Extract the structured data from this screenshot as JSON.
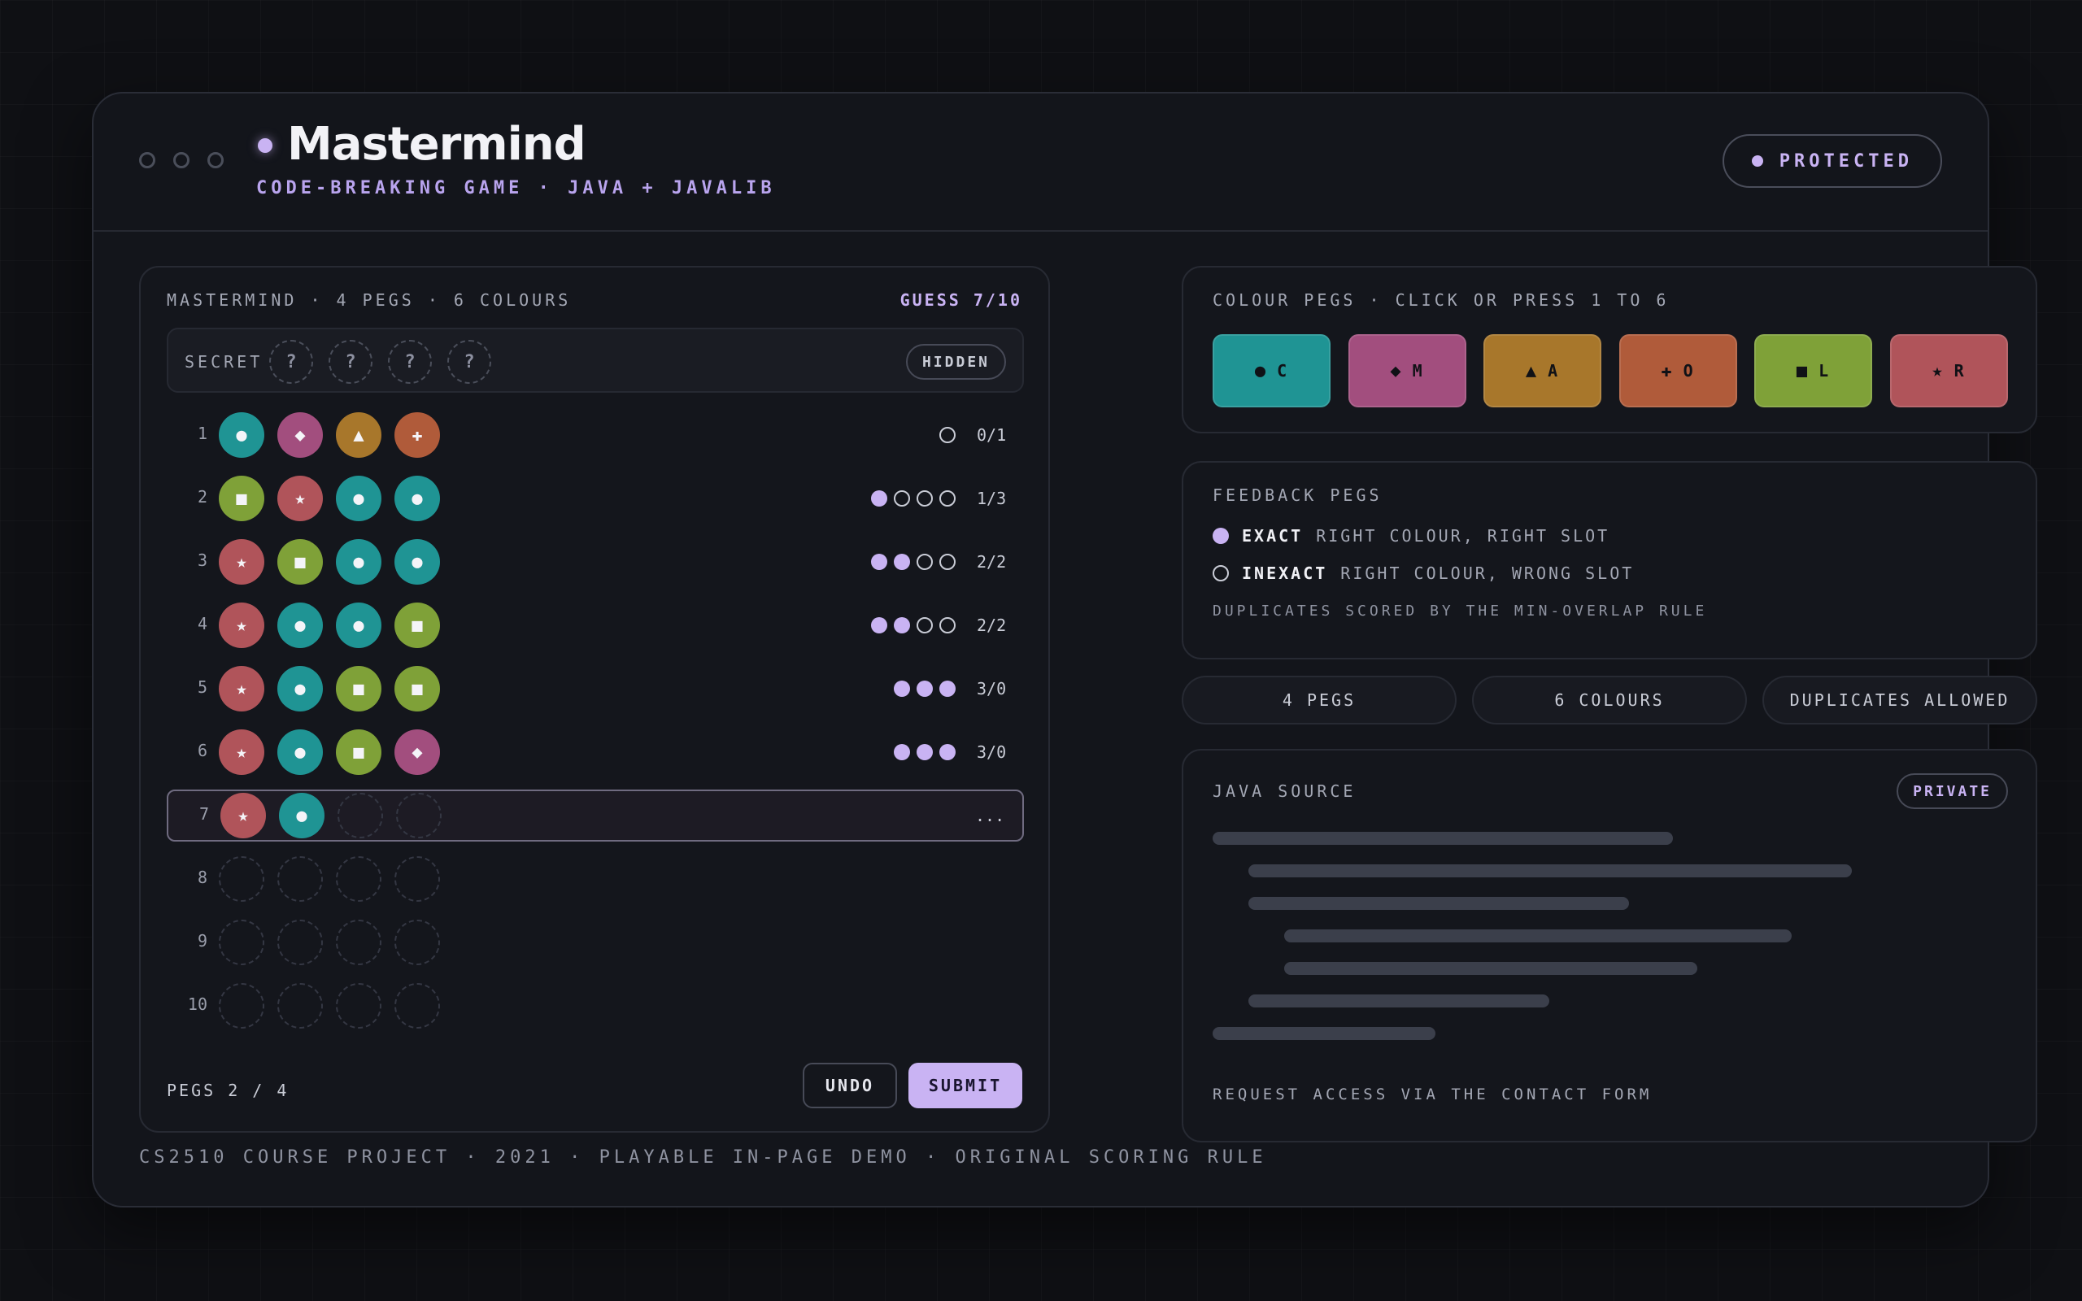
{
  "app": {
    "title": "Mastermind",
    "subtitle": "CODE-BREAKING GAME · JAVA + JAVALIB",
    "badge": "PROTECTED"
  },
  "board": {
    "header": "MASTERMIND · 4 PEGS · 6 COLOURS",
    "guess_label": "GUESS 7/10",
    "secret_label": "SECRET",
    "secret_pegs": [
      "?",
      "?",
      "?",
      "?"
    ],
    "secret_state": "HIDDEN",
    "rows": [
      {
        "num": "1",
        "pegs": [
          "C",
          "M",
          "A",
          "O"
        ],
        "exact": 0,
        "inexact": 1,
        "score": "0/1"
      },
      {
        "num": "2",
        "pegs": [
          "L",
          "R",
          "C",
          "C"
        ],
        "exact": 1,
        "inexact": 3,
        "score": "1/3"
      },
      {
        "num": "3",
        "pegs": [
          "R",
          "L",
          "C",
          "C"
        ],
        "exact": 2,
        "inexact": 2,
        "score": "2/2"
      },
      {
        "num": "4",
        "pegs": [
          "R",
          "C",
          "C",
          "L"
        ],
        "exact": 2,
        "inexact": 2,
        "score": "2/2"
      },
      {
        "num": "5",
        "pegs": [
          "R",
          "C",
          "L",
          "L"
        ],
        "exact": 3,
        "inexact": 0,
        "score": "3/0"
      },
      {
        "num": "6",
        "pegs": [
          "R",
          "C",
          "L",
          "M"
        ],
        "exact": 3,
        "inexact": 0,
        "score": "3/0"
      },
      {
        "num": "7",
        "pegs": [
          "R",
          "C",
          "",
          ""
        ],
        "active": true,
        "score": "..."
      },
      {
        "num": "8",
        "pegs": [
          "",
          "",
          "",
          ""
        ]
      },
      {
        "num": "9",
        "pegs": [
          "",
          "",
          "",
          ""
        ]
      },
      {
        "num": "10",
        "pegs": [
          "",
          "",
          "",
          ""
        ]
      }
    ],
    "pegs_count": "PEGS 2 / 4",
    "undo_label": "UNDO",
    "submit_label": "SUBMIT"
  },
  "colours": {
    "C": {
      "hex": "#1f9494",
      "icon": "circle-icon",
      "glyph": "●"
    },
    "M": {
      "hex": "#a24e7e",
      "icon": "diamond-icon",
      "glyph": "◆"
    },
    "A": {
      "hex": "#a8772b",
      "icon": "triangle-icon",
      "glyph": "▲"
    },
    "O": {
      "hex": "#b05b3a",
      "icon": "cross-icon",
      "glyph": "✚"
    },
    "L": {
      "hex": "#7fa138",
      "icon": "square-icon",
      "glyph": "■"
    },
    "R": {
      "hex": "#b0545a",
      "icon": "star-icon",
      "glyph": "★"
    }
  },
  "palette": {
    "label": "COLOUR PEGS · CLICK OR PRESS 1 TO 6",
    "order": [
      "C",
      "M",
      "A",
      "O",
      "L",
      "R"
    ]
  },
  "feedback_legend": {
    "label": "FEEDBACK PEGS",
    "exact_key": "EXACT",
    "exact_desc": "RIGHT COLOUR, RIGHT SLOT",
    "inexact_key": "INEXACT",
    "inexact_desc": "RIGHT COLOUR, WRONG SLOT",
    "note": "DUPLICATES SCORED BY THE MIN-OVERLAP RULE"
  },
  "chips": [
    "4 PEGS",
    "6 COLOURS",
    "DUPLICATES ALLOWED"
  ],
  "source": {
    "label": "JAVA SOURCE",
    "badge": "PRIVATE",
    "request": "REQUEST ACCESS VIA THE CONTACT FORM"
  },
  "footer": "CS2510 COURSE PROJECT · 2021 · PLAYABLE IN-PAGE DEMO · ORIGINAL SCORING RULE",
  "accent": "#c9b3f3"
}
